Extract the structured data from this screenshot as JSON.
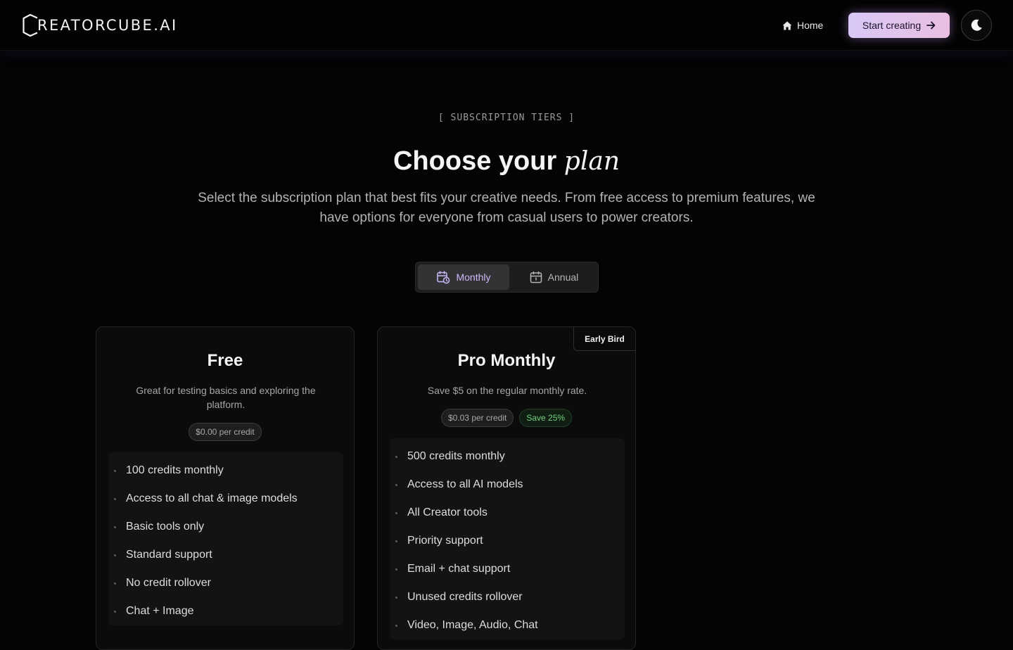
{
  "header": {
    "logo_text": "REATORCUBE.AI",
    "nav_home_label": "Home",
    "cta_label": "Start creating",
    "icons": {
      "home": "home-icon",
      "arrow": "arrow-right-icon",
      "theme": "moon-icon"
    }
  },
  "hero": {
    "eyebrow": "[ SUBSCRIPTION TIERS ]",
    "title_main": "Choose your",
    "title_em": "plan",
    "subtitle": "Select the subscription plan that best fits your creative needs. From free access to premium features, we have options for everyone from casual users to power creators."
  },
  "billing_toggle": {
    "selected": "Monthly",
    "options": [
      {
        "label": "Monthly",
        "icon": "calendar-clock-icon"
      },
      {
        "label": "Annual",
        "icon": "calendar-icon"
      }
    ]
  },
  "plans": [
    {
      "name": "Free",
      "description": "Great for testing basics and exploring the platform.",
      "price_per_credit": "$0.00 per credit",
      "features": [
        "100 credits monthly",
        "Access to all chat & image models",
        "Basic tools only",
        "Standard support",
        "No credit rollover",
        "Chat + Image"
      ]
    },
    {
      "name": "Pro Monthly",
      "badge": "Early Bird",
      "description": "Save $5 on the regular monthly rate.",
      "price_per_credit": "$0.03 per credit",
      "savings": "Save 25%",
      "features": [
        "500 credits monthly",
        "Access to all AI models",
        "All Creator tools",
        "Priority support",
        "Email + chat support",
        "Unused credits rollover",
        "Video, Image, Audio, Chat"
      ]
    }
  ],
  "colors": {
    "background": "#040404",
    "accent_start": "#d9c8f7",
    "accent_end": "#e9bfe1",
    "toggle_selected_text": "#c9b8f5",
    "save_green": "#6fd47c"
  }
}
